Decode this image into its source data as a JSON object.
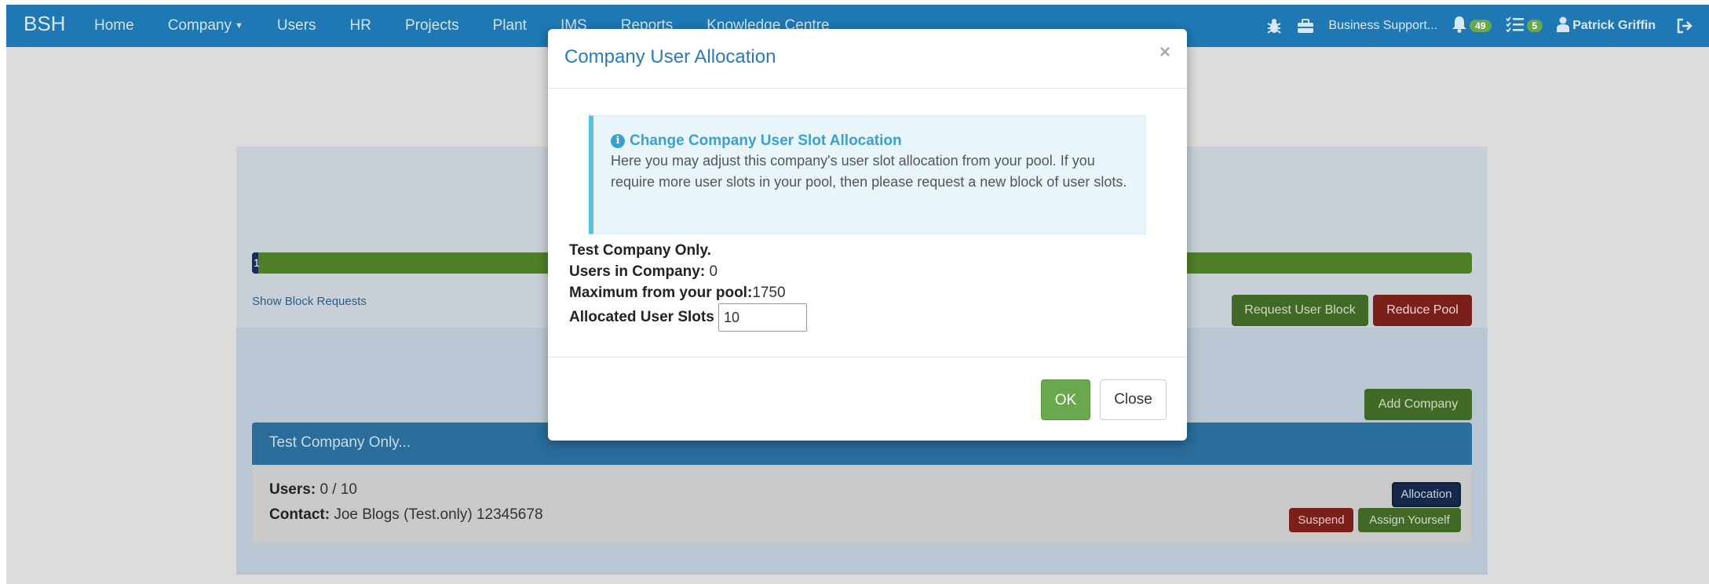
{
  "navbar": {
    "brand": "BSH",
    "items": [
      {
        "label": "Home"
      },
      {
        "label": "Company"
      },
      {
        "label": "Users"
      },
      {
        "label": "HR"
      },
      {
        "label": "Projects"
      },
      {
        "label": "Plant"
      },
      {
        "label": "IMS"
      },
      {
        "label": "Reports"
      },
      {
        "label": "Knowledge Centre"
      }
    ],
    "business": "Business Support...",
    "notifications_count": "49",
    "tasks_count": "5",
    "user_name": "Patrick Griffin"
  },
  "page": {
    "progress_label": "1",
    "progress_fraction": 0.005,
    "show_block_requests": "Show Block Requests",
    "request_user_block": "Request User Block",
    "reduce_pool": "Reduce Pool",
    "add_company": "Add Company",
    "company": {
      "name": "Test Company Only...",
      "users_label": "Users:",
      "users_value": "0 / 10",
      "contact_label": "Contact:",
      "contact_value": "Joe Blogs (Test.only) 12345678",
      "allocation_button": "Allocation",
      "suspend_button": "Suspend",
      "assign_button": "Assign Yourself"
    }
  },
  "modal": {
    "title": "Company User Allocation",
    "close_symbol": "×",
    "alert_title": "Change Company User Slot Allocation",
    "alert_text": "Here you may adjust this company's user slot allocation from your pool. If you require more user slots in your pool, then please request a new block of user slots.",
    "company_name": "Test Company Only.",
    "users_in_company_label": "Users in Company:",
    "users_in_company_value": "0",
    "max_from_pool_label": "Maximum from your pool:",
    "max_from_pool_value": "1750",
    "allocated_slots_label": "Allocated User Slots",
    "allocated_slots_value": "10",
    "ok_button": "OK",
    "close_button": "Close"
  }
}
